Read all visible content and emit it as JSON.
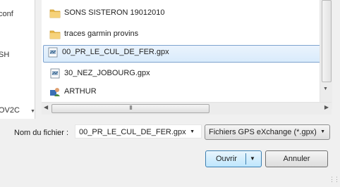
{
  "nav_pane": {
    "items": [
      {
        "label": "conf"
      },
      {
        "label": "SH"
      },
      {
        "label": "OV2C"
      }
    ]
  },
  "file_list": {
    "items": [
      {
        "name": "SONS SISTERON 19012010",
        "icon": "folder-icon",
        "selected": false
      },
      {
        "name": "traces garmin provins",
        "icon": "folder-icon",
        "selected": false
      },
      {
        "name": "00_PR_LE_CUL_DE_FER.gpx",
        "icon": "gpx-file-icon",
        "selected": true
      },
      {
        "name": "30_NEZ_JOBOURG.gpx",
        "icon": "gpx-file-icon",
        "selected": false
      },
      {
        "name": "ARTHUR",
        "icon": "user-folder-icon",
        "selected": false
      }
    ]
  },
  "horizontal_scrollbar": {
    "thumb_grip": "III"
  },
  "filename": {
    "label": "Nom du fichier :",
    "value": "00_PR_LE_CUL_DE_FER.gpx"
  },
  "filetype": {
    "value": "Fichiers GPS eXchange (*.gpx)"
  },
  "buttons": {
    "open": "Ouvrir",
    "cancel": "Annuler"
  },
  "colors": {
    "folder": "#e8b84a",
    "selection": "#d9ebfb",
    "selection_border": "#7da2ce",
    "open_button": "#bee6fd"
  }
}
